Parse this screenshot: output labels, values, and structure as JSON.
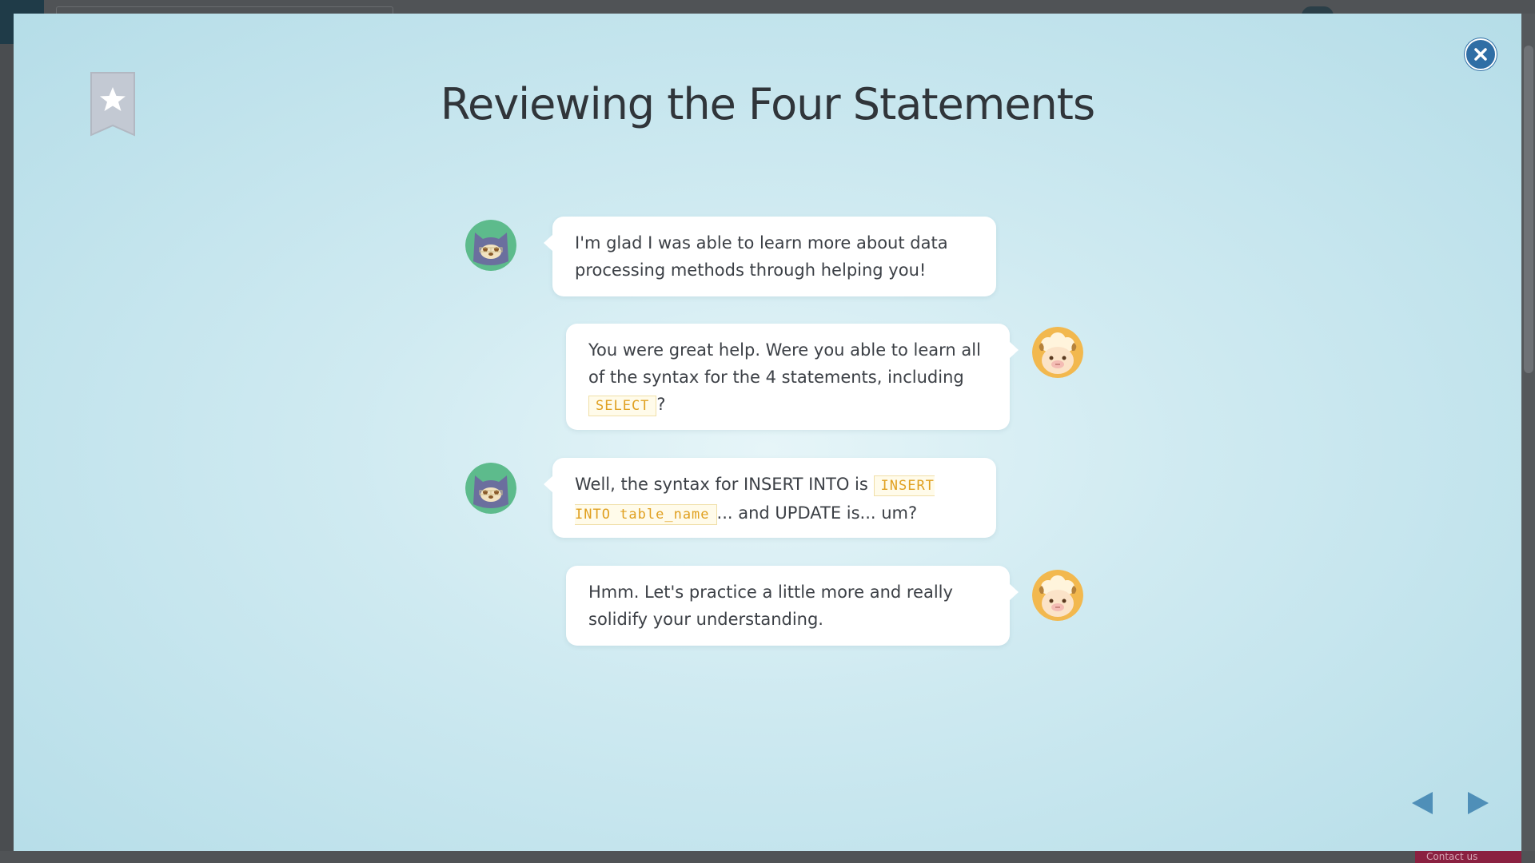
{
  "modal": {
    "title": "Reviewing the Four Statements"
  },
  "messages": [
    {
      "speaker": "cat",
      "side": "left",
      "parts": [
        {
          "type": "text",
          "text": "I'm glad I was able to learn more about data processing methods through helping you!"
        }
      ]
    },
    {
      "speaker": "sheep",
      "side": "right",
      "parts": [
        {
          "type": "text",
          "text": "You were great help. Were you able to learn all of the syntax for the 4 statements, including "
        },
        {
          "type": "code",
          "text": "SELECT"
        },
        {
          "type": "text",
          "text": "?"
        }
      ]
    },
    {
      "speaker": "cat",
      "side": "left",
      "parts": [
        {
          "type": "text",
          "text": "Well, the syntax for INSERT INTO is "
        },
        {
          "type": "code",
          "text": "INSERT INTO table_name"
        },
        {
          "type": "text",
          "text": "... and UPDATE is... um?"
        }
      ]
    },
    {
      "speaker": "sheep",
      "side": "right",
      "parts": [
        {
          "type": "text",
          "text": "Hmm. Let's practice a little more and really solidify your understanding."
        }
      ]
    }
  ],
  "background": {
    "contact_label": "Contact us"
  },
  "icons": {
    "bookmark": "bookmark-star-icon",
    "close": "close-icon",
    "prev": "triangle-left-icon",
    "next": "triangle-right-icon"
  },
  "colors": {
    "accent_blue": "#2f6ea5",
    "code_text": "#e0a020",
    "nav_arrow": "#4f8fb8",
    "cat_avatar_bg": "#5dbb8c",
    "sheep_avatar_bg": "#f2b84e"
  }
}
